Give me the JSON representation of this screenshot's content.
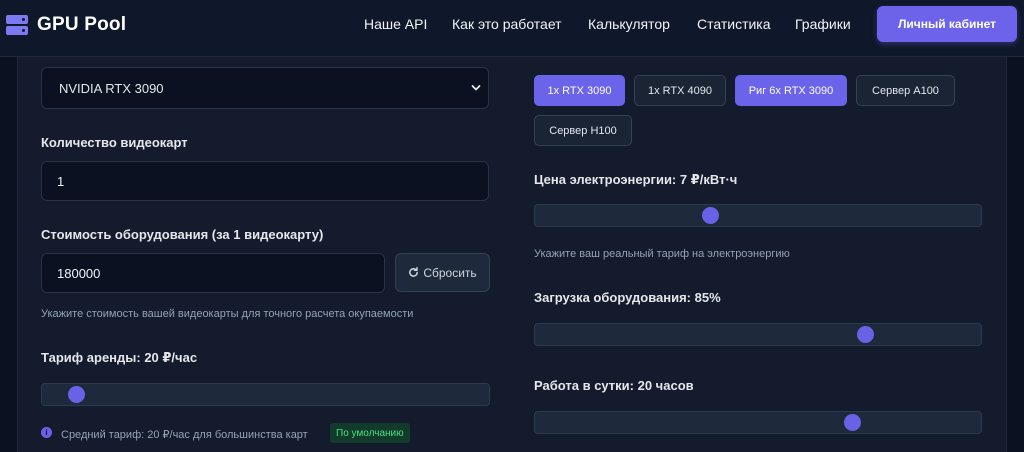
{
  "header": {
    "logo_text": "GPU Pool",
    "nav": [
      "Наше API",
      "Как это работает",
      "Калькулятор",
      "Статистика",
      "Графики"
    ],
    "cabinet_label": "Личный кабинет"
  },
  "colors": {
    "background": "#0b1120",
    "panel": "#131b2c",
    "accent": "#6d63ea",
    "badge_text": "#4ade80"
  },
  "left": {
    "gpu_select": {
      "value": "NVIDIA RTX 3090"
    },
    "quantity": {
      "label": "Количество видеокарт",
      "value": "1"
    },
    "cost": {
      "label": "Стоимость оборудования (за 1 видеокарту)",
      "value": "180000",
      "reset_label": "Сбросить",
      "hint": "Укажите стоимость вашей видеокарты для точного расчета окупаемости"
    },
    "rent": {
      "label": "Тариф аренды: 20 ₽/час",
      "slider_fraction": 0.06,
      "hint": "Средний тариф: 20 ₽/час для большинства карт",
      "badge": "По умолчанию"
    }
  },
  "right": {
    "presets": [
      {
        "label": "1x RTX 3090",
        "active": true
      },
      {
        "label": "1x RTX 4090",
        "active": false
      },
      {
        "label": "Риг 6x RTX 3090",
        "active": true
      },
      {
        "label": "Сервер A100",
        "active": false
      },
      {
        "label": "Сервер H100",
        "active": false
      }
    ],
    "electricity": {
      "label": "Цена электроэнергии: 7 ₽/кВт·ч",
      "slider_fraction": 0.39,
      "hint": "Укажите ваш реальный тариф на электроэнергию"
    },
    "load": {
      "label": "Загрузка оборудования: 85%",
      "slider_fraction": 0.75
    },
    "hours": {
      "label": "Работа в сутки: 20 часов",
      "slider_fraction": 0.72
    }
  },
  "icons": [
    "server-logo-icon",
    "chevron-down-icon",
    "refresh-icon",
    "info-icon"
  ]
}
